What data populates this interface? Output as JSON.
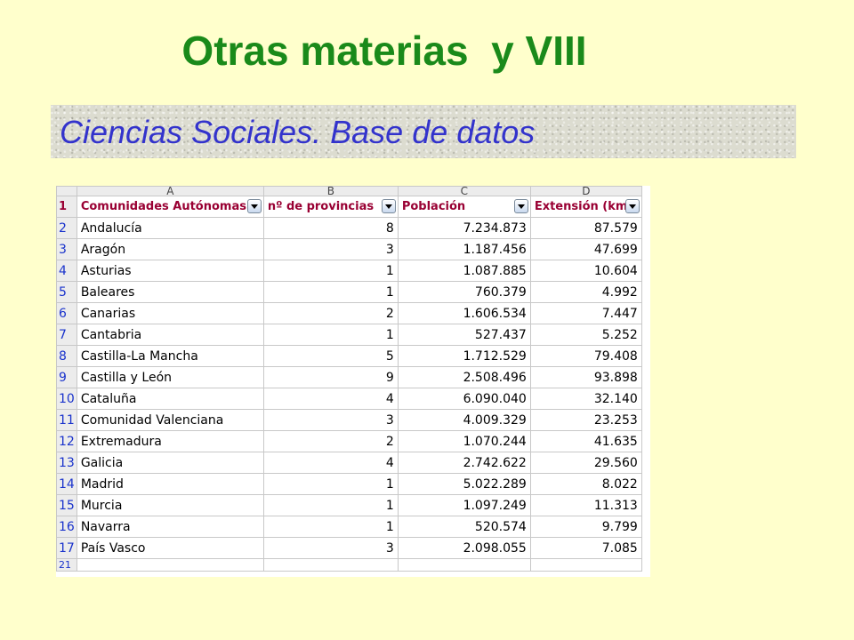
{
  "slide": {
    "title": "Otras materias  y VIII",
    "subtitle": "Ciencias Sociales. Base de datos"
  },
  "spreadsheet": {
    "column_letters": [
      "A",
      "B",
      "C",
      "D"
    ],
    "headers": [
      "Comunidades Autónomas",
      "nº de provincias",
      "Población",
      "Extensión (km"
    ],
    "rows": [
      {
        "row": "2",
        "comunidad": "Andalucía",
        "provincias": "8",
        "poblacion": "7.234.873",
        "extension": "87.579"
      },
      {
        "row": "3",
        "comunidad": "Aragón",
        "provincias": "3",
        "poblacion": "1.187.456",
        "extension": "47.699"
      },
      {
        "row": "4",
        "comunidad": "Asturias",
        "provincias": "1",
        "poblacion": "1.087.885",
        "extension": "10.604"
      },
      {
        "row": "5",
        "comunidad": "Baleares",
        "provincias": "1",
        "poblacion": "760.379",
        "extension": "4.992"
      },
      {
        "row": "6",
        "comunidad": "Canarias",
        "provincias": "2",
        "poblacion": "1.606.534",
        "extension": "7.447"
      },
      {
        "row": "7",
        "comunidad": "Cantabria",
        "provincias": "1",
        "poblacion": "527.437",
        "extension": "5.252"
      },
      {
        "row": "8",
        "comunidad": "Castilla-La Mancha",
        "provincias": "5",
        "poblacion": "1.712.529",
        "extension": "79.408"
      },
      {
        "row": "9",
        "comunidad": "Castilla y León",
        "provincias": "9",
        "poblacion": "2.508.496",
        "extension": "93.898"
      },
      {
        "row": "10",
        "comunidad": "Cataluña",
        "provincias": "4",
        "poblacion": "6.090.040",
        "extension": "32.140"
      },
      {
        "row": "11",
        "comunidad": "Comunidad Valenciana",
        "provincias": "3",
        "poblacion": "4.009.329",
        "extension": "23.253"
      },
      {
        "row": "12",
        "comunidad": "Extremadura",
        "provincias": "2",
        "poblacion": "1.070.244",
        "extension": "41.635"
      },
      {
        "row": "13",
        "comunidad": "Galicia",
        "provincias": "4",
        "poblacion": "2.742.622",
        "extension": "29.560"
      },
      {
        "row": "14",
        "comunidad": "Madrid",
        "provincias": "1",
        "poblacion": "5.022.289",
        "extension": "8.022"
      },
      {
        "row": "15",
        "comunidad": "Murcia",
        "provincias": "1",
        "poblacion": "1.097.249",
        "extension": "11.313"
      },
      {
        "row": "16",
        "comunidad": "Navarra",
        "provincias": "1",
        "poblacion": "520.574",
        "extension": "9.799"
      },
      {
        "row": "17",
        "comunidad": "País Vasco",
        "provincias": "3",
        "poblacion": "2.098.055",
        "extension": "7.085"
      }
    ],
    "last_row_number": "21"
  }
}
